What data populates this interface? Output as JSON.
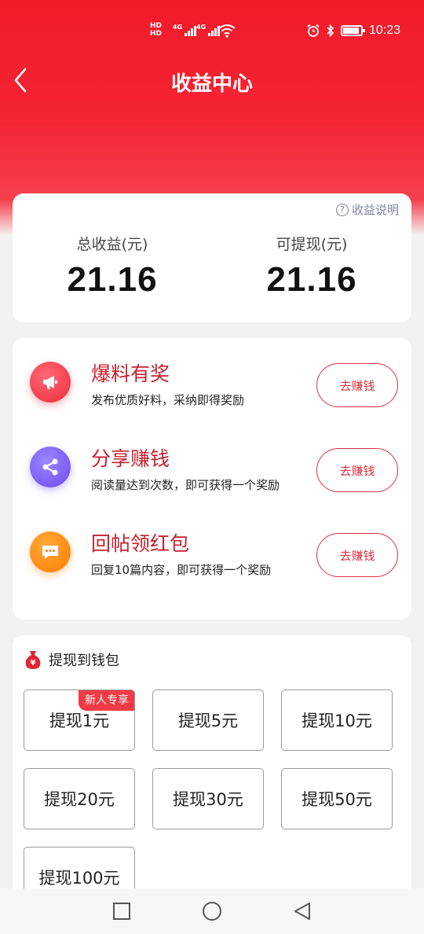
{
  "status_bar": {
    "hd_labels": [
      "HD",
      "HD"
    ],
    "network_labels": [
      "4G",
      "4G"
    ],
    "time": "10:23",
    "icons": [
      "alarm-icon",
      "bluetooth-icon",
      "battery-icon",
      "wifi-icon",
      "signal-icon"
    ]
  },
  "header": {
    "title": "收益中心",
    "back_icon": "back-arrow-icon"
  },
  "earnings": {
    "explain_label": "收益说明",
    "total_label": "总收益(元)",
    "total_value": "21.16",
    "withdrawable_label": "可提现(元)",
    "withdrawable_value": "21.16"
  },
  "tasks": [
    {
      "icon": "megaphone-icon",
      "title": "爆料有奖",
      "desc": "发布优质好料，采纳即得奖励",
      "button": "去赚钱",
      "color": "#ee2b3b"
    },
    {
      "icon": "share-icon",
      "title": "分享赚钱",
      "desc": "阅读量达到次数，即可获得一个奖励",
      "button": "去赚钱",
      "color": "#6c4cf2"
    },
    {
      "icon": "chat-icon",
      "title": "回帖领红包",
      "desc": "回复10篇内容，即可获得一个奖励",
      "button": "去赚钱",
      "color": "#ff7a00"
    }
  ],
  "withdraw": {
    "title": "提现到钱包",
    "icon": "money-bag-icon",
    "options": [
      {
        "label": "提现1元",
        "badge": "新人专享"
      },
      {
        "label": "提现5元"
      },
      {
        "label": "提现10元"
      },
      {
        "label": "提现20元"
      },
      {
        "label": "提现30元"
      },
      {
        "label": "提现50元"
      },
      {
        "label": "提现100元"
      }
    ]
  },
  "navbar": {
    "icons": [
      "recent-apps-icon",
      "home-icon",
      "back-icon"
    ]
  },
  "colors": {
    "header_red": "#f21b2a",
    "accent_red": "#c8202e",
    "button_border": "#d7323e"
  }
}
